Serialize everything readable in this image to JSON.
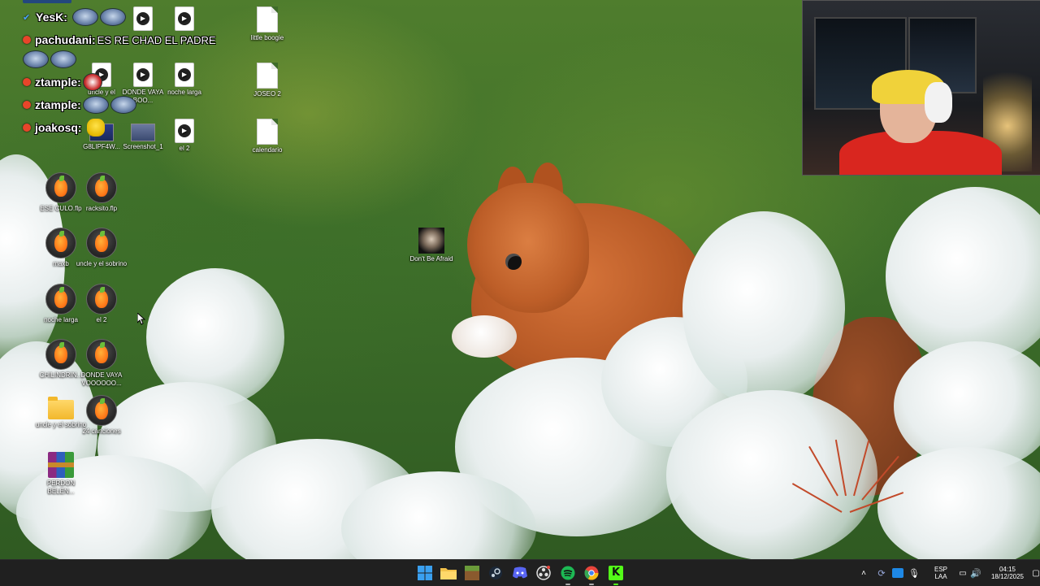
{
  "desktop": {
    "icons": [
      {
        "label": "",
        "type": "video"
      },
      {
        "label": "",
        "type": "video"
      },
      {
        "label": "little boogie",
        "type": "file"
      },
      {
        "label": "uncle y el",
        "type": "video"
      },
      {
        "label": "DONDE VAYA BOO...",
        "type": "video"
      },
      {
        "label": "noche larga",
        "type": "video"
      },
      {
        "label": "JOSEO 2",
        "type": "file"
      },
      {
        "label": "G8LIPF4W...",
        "type": "image"
      },
      {
        "label": "Screenshot_1",
        "type": "image"
      },
      {
        "label": "el 2",
        "type": "video"
      },
      {
        "label": "calendario",
        "type": "file"
      },
      {
        "label": "ESE CULO.flp",
        "type": "fl"
      },
      {
        "label": "racksito.flp",
        "type": "fl"
      },
      {
        "label": "maxb",
        "type": "fl"
      },
      {
        "label": "uncle y el sobrino",
        "type": "fl"
      },
      {
        "label": "noche larga",
        "type": "fl"
      },
      {
        "label": "el 2",
        "type": "fl"
      },
      {
        "label": "CHILINDRIN...",
        "type": "fl"
      },
      {
        "label": "DONDE VAYA VOOOOOO...",
        "type": "fl"
      },
      {
        "label": "uncle y el sobrino",
        "type": "folder"
      },
      {
        "label": "24 canciones",
        "type": "fl"
      },
      {
        "label": "PERDON BELEN...",
        "type": "rar"
      },
      {
        "label": "Don't Be Afraid",
        "type": "shortcut"
      }
    ]
  },
  "chat": {
    "messages": [
      {
        "user": "YesK:",
        "badge": "check",
        "text": ""
      },
      {
        "user": "pachudani:",
        "badge": "dot",
        "text": "ES RE CHAD EL PADRE"
      },
      {
        "user": "",
        "badge": "",
        "text": ""
      },
      {
        "user": "ztample:",
        "badge": "dot",
        "text": ""
      },
      {
        "user": "ztample:",
        "badge": "dot",
        "text": ""
      },
      {
        "user": "joakosq:",
        "badge": "dot",
        "text": ""
      }
    ]
  },
  "taskbar": {
    "apps": [
      {
        "name": "start",
        "icon": "windows-icon",
        "color": "#3aa0f0"
      },
      {
        "name": "file-explorer",
        "icon": "folder-icon",
        "color": "#f2c14a"
      },
      {
        "name": "minecraft",
        "icon": "grass-block-icon",
        "color": "#6b9b3a"
      },
      {
        "name": "steam",
        "icon": "steam-icon",
        "color": "#c7d5e0"
      },
      {
        "name": "discord",
        "icon": "discord-icon",
        "color": "#5865f2"
      },
      {
        "name": "obs",
        "icon": "obs-icon",
        "color": "#e0e0e0"
      },
      {
        "name": "spotify",
        "icon": "spotify-icon",
        "color": "#1db954"
      },
      {
        "name": "chrome",
        "icon": "chrome-icon",
        "color": "#e8453c"
      },
      {
        "name": "kick",
        "icon": "kick-icon",
        "color": "#53fc18"
      }
    ],
    "tray": {
      "language_top": "ESP",
      "language_bottom": "LAA",
      "time": "04:15",
      "date": "18/12/2025"
    }
  }
}
